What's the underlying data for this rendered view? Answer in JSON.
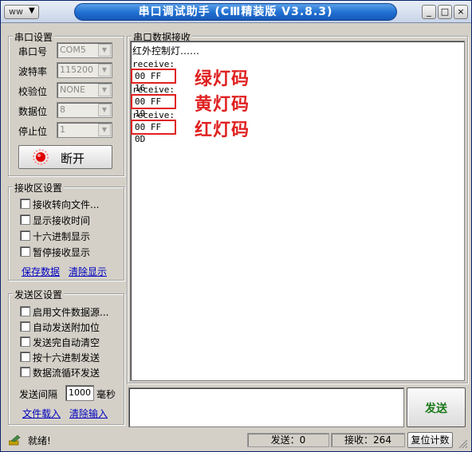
{
  "window": {
    "title": "串口调试助手 (CⅢ精装版 V3.8.3)",
    "sysmenu_icon": "ww-icon",
    "buttons": {
      "minimize": "_",
      "maximize": "□",
      "close": "×"
    }
  },
  "serial_settings": {
    "title": "串口设置",
    "fields": [
      {
        "label": "串口号",
        "value": "COM5"
      },
      {
        "label": "波特率",
        "value": "115200"
      },
      {
        "label": "校验位",
        "value": "NONE"
      },
      {
        "label": "数据位",
        "value": "8"
      },
      {
        "label": "停止位",
        "value": "1"
      }
    ],
    "open_button": "断开"
  },
  "receive_settings": {
    "title": "接收区设置",
    "options": [
      "接收转向文件...",
      "显示接收时间",
      "十六进制显示",
      "暂停接收显示"
    ],
    "save_link": "保存数据",
    "clear_link": "清除显示"
  },
  "send_settings": {
    "title": "发送区设置",
    "options": [
      "启用文件数据源...",
      "自动发送附加位",
      "发送完自动清空",
      "按十六进制发送",
      "数据流循环发送"
    ],
    "interval_label": "发送间隔",
    "interval_value": "1000",
    "interval_unit": "毫秒",
    "load_link": "文件载入",
    "clear_link": "清除输入"
  },
  "receive_area": {
    "title": "串口数据接收",
    "header_line": "红外控制灯……",
    "receive_label": "receive:",
    "codes": [
      "00 FF 16",
      "00 FF 19",
      "00 FF 0D"
    ],
    "annotations": [
      "绿灯码",
      "黄灯码",
      "红灯码"
    ]
  },
  "send_button": "发送",
  "status_bar": {
    "ready": "就绪!",
    "send_count": "发送：0",
    "recv_count": "接收：264",
    "reset_button": "复位计数"
  },
  "colors": {
    "annotation": "#e02020",
    "link": "#0000c0",
    "send_button_text": "#1a7a1a"
  }
}
